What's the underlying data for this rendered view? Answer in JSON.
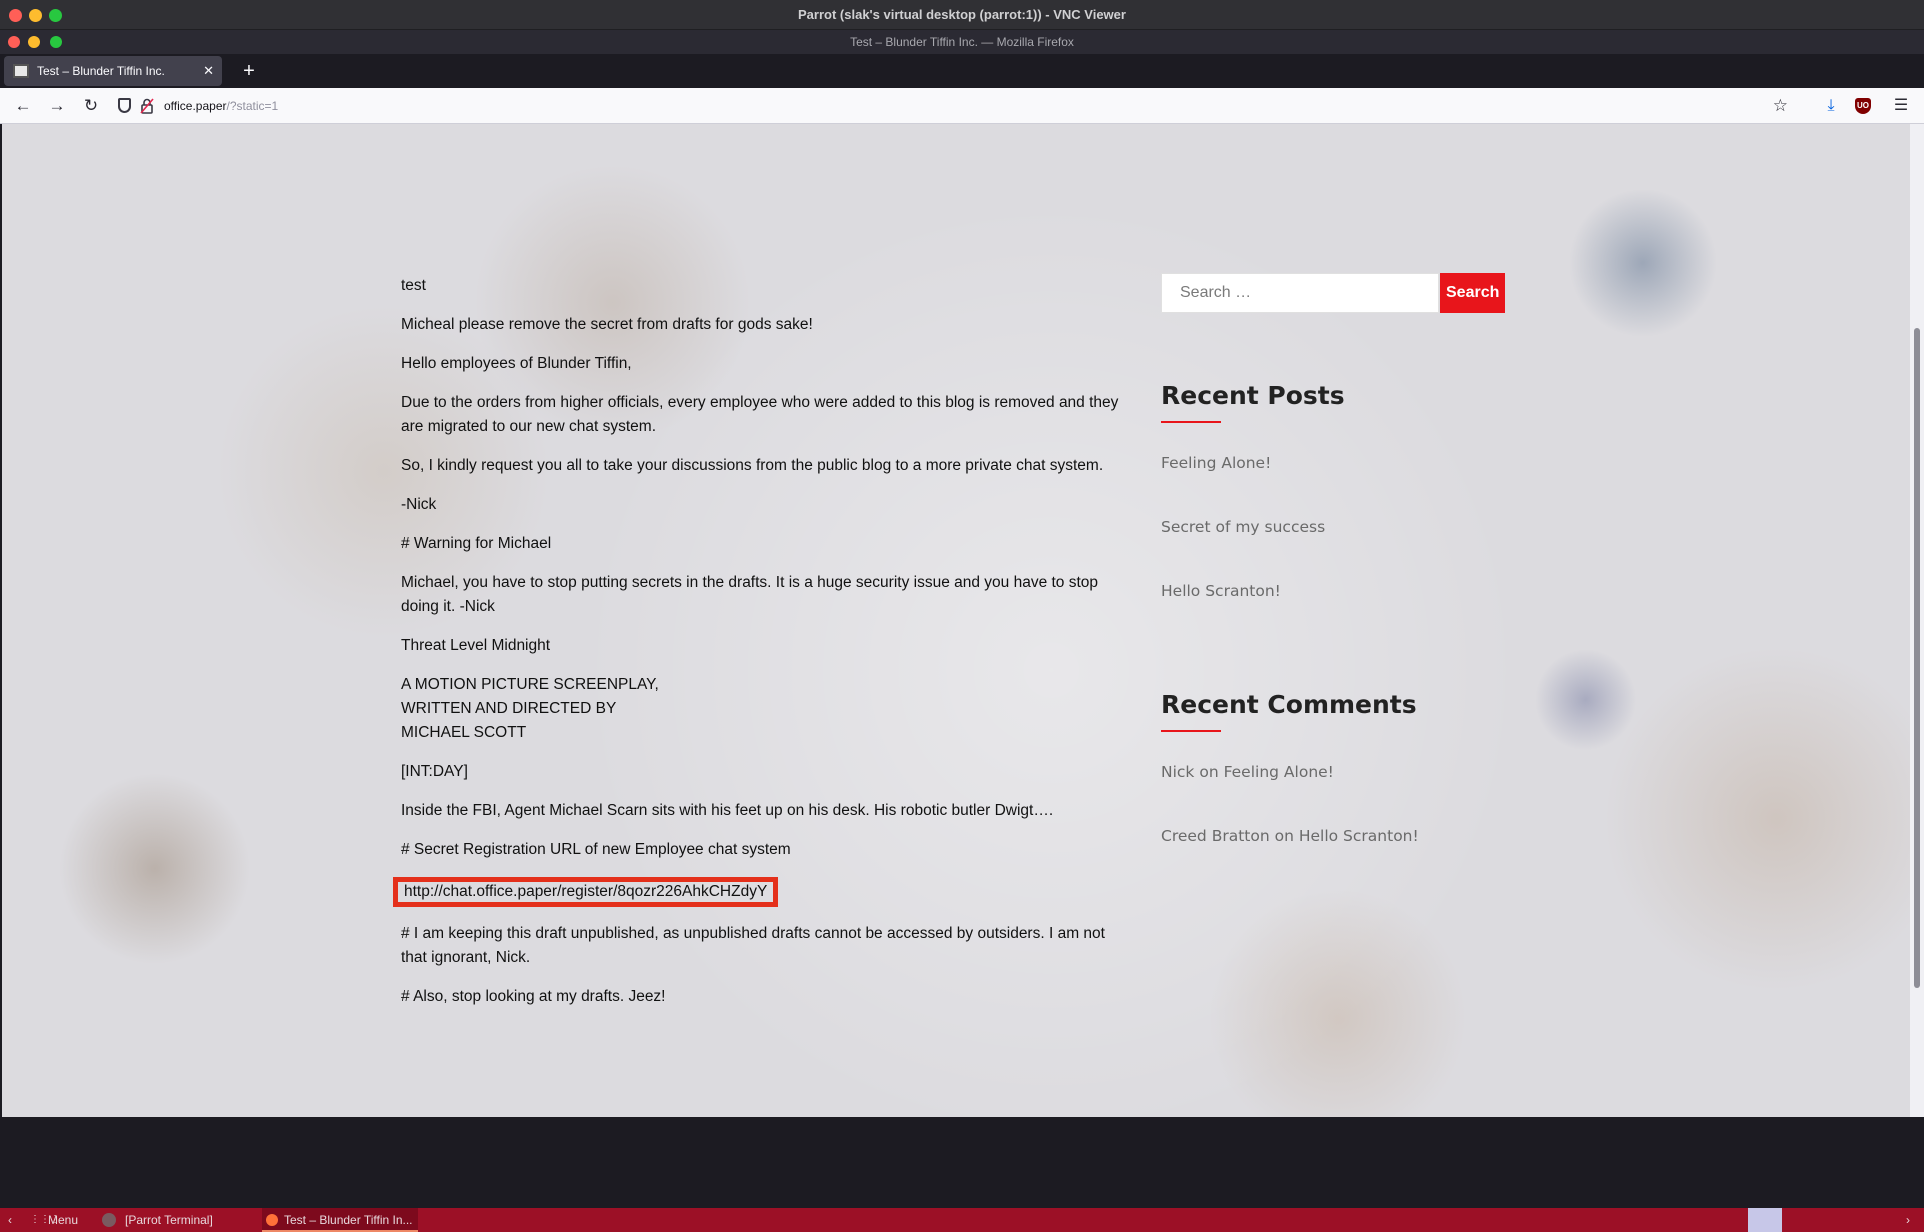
{
  "vnc": {
    "title": "Parrot (slak's virtual desktop (parrot:1)) - VNC Viewer"
  },
  "firefox": {
    "window_title": "Test – Blunder Tiffin Inc. — Mozilla Firefox"
  },
  "tabs": [
    {
      "label": "Test – Blunder Tiffin Inc."
    }
  ],
  "tab_close": "✕",
  "new_tab": "+",
  "nav": {
    "back": "←",
    "forward": "→",
    "reload": "↻",
    "star": "☆",
    "download": "⤓",
    "menu": "☰",
    "ublock_label": "UO"
  },
  "address": {
    "host": "office.paper",
    "path": "/?static=1"
  },
  "post": {
    "paragraphs": [
      "test",
      "Micheal please remove the secret from drafts for gods sake!",
      "Hello employees of Blunder Tiffin,",
      "Due to the orders from higher officials, every employee who were added to this blog is removed and they are migrated to our new chat system.",
      "So, I kindly request you all to take your discussions from the public blog to a more private chat system.",
      "-Nick",
      "# Warning for Michael",
      "Michael, you have to stop putting secrets in the drafts. It is a huge security issue and you have to stop doing it. -Nick",
      "Threat Level Midnight"
    ],
    "screenplay": [
      "A MOTION PICTURE SCREENPLAY,",
      "WRITTEN AND DIRECTED BY",
      "MICHAEL SCOTT"
    ],
    "paragraphs2": [
      "[INT:DAY]",
      "Inside the FBI, Agent Michael Scarn sits with his feet up on his desk. His robotic butler Dwigt….",
      "# Secret Registration URL of new Employee chat system"
    ],
    "secret_url": "http://chat.office.paper/register/8qozr226AhkCHZdyY",
    "paragraphs3": [
      "# I am keeping this draft unpublished, as unpublished drafts cannot be accessed by outsiders. I am not that ignorant, Nick.",
      "# Also, stop looking at my drafts. Jeez!"
    ]
  },
  "sidebar": {
    "search": {
      "placeholder": "Search …",
      "button": "Search"
    },
    "recent_posts": {
      "title": "Recent Posts",
      "items": [
        "Feeling Alone!",
        "Secret of my success",
        "Hello Scranton!"
      ]
    },
    "recent_comments": {
      "title": "Recent Comments",
      "items": [
        {
          "author": "Nick",
          "sep": " on ",
          "post": "Feeling Alone!"
        },
        {
          "author": "Creed Bratton",
          "sep": " on ",
          "post": "Hello Scranton!"
        }
      ]
    }
  },
  "taskbar": {
    "menu": "Menu",
    "terminal": "[Parrot Terminal]",
    "firefox": "Test – Blunder Tiffin In..."
  },
  "colors": {
    "accent": "#e8151b",
    "highlight_box": "#e4301b",
    "taskbar": "#9c1026"
  }
}
